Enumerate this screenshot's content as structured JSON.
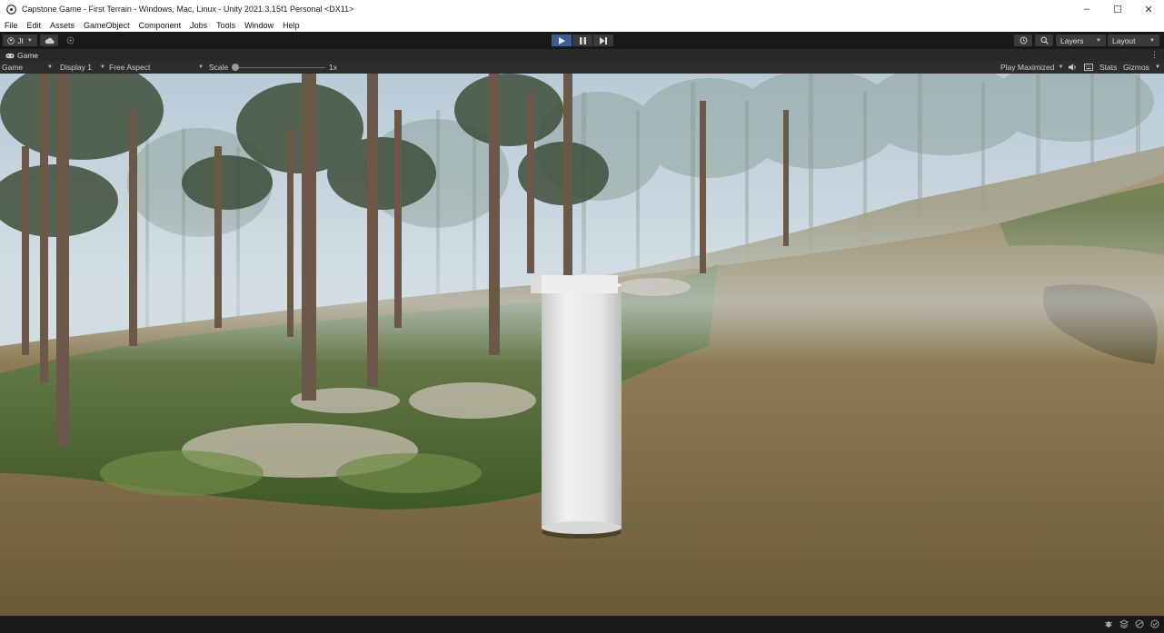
{
  "window": {
    "title": "Capstone Game - First Terrain - Windows, Mac, Linux - Unity 2021.3.15f1 Personal <DX11>",
    "controls": {
      "minimize": "–",
      "maximize": "☐",
      "close": "✕"
    }
  },
  "menu": {
    "items": [
      "File",
      "Edit",
      "Assets",
      "GameObject",
      "Component",
      "Jobs",
      "Tools",
      "Window",
      "Help"
    ]
  },
  "toolbar": {
    "account_label": "JI",
    "layers_label": "Layers",
    "layout_label": "Layout"
  },
  "tab": {
    "label": "Game"
  },
  "game_toolbar": {
    "view_mode": "Game",
    "display": "Display 1",
    "aspect": "Free Aspect",
    "scale_label": "Scale",
    "scale_value": "1x",
    "scale_fraction": 0.0,
    "play_mode": "Play Maximized",
    "stats_label": "Stats",
    "gizmos_label": "Gizmos"
  },
  "colors": {
    "play_active": "#3c5f92",
    "editor_dark": "#191919",
    "panel": "#282828"
  }
}
